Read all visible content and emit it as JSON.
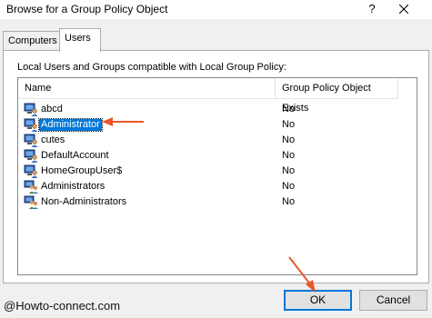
{
  "window": {
    "title": "Browse for a Group Policy Object",
    "help_label": "?"
  },
  "tabs": [
    {
      "label": "Computers",
      "active": false
    },
    {
      "label": "Users",
      "active": true
    }
  ],
  "panel": {
    "caption": "Local Users and Groups compatible with Local Group Policy:"
  },
  "list": {
    "columns": [
      "Name",
      "Group Policy Object Exists"
    ],
    "rows": [
      {
        "name": "abcd",
        "exists": "No",
        "icon": "user-icon"
      },
      {
        "name": "Administrator",
        "exists": "No",
        "icon": "user-icon",
        "selected": true
      },
      {
        "name": "cutes",
        "exists": "No",
        "icon": "user-icon"
      },
      {
        "name": "DefaultAccount",
        "exists": "No",
        "icon": "user-icon"
      },
      {
        "name": "HomeGroupUser$",
        "exists": "No",
        "icon": "user-icon"
      },
      {
        "name": "Administrators",
        "exists": "No",
        "icon": "group-icon"
      },
      {
        "name": "Non-Administrators",
        "exists": "No",
        "icon": "group-icon"
      }
    ]
  },
  "buttons": {
    "ok": "OK",
    "cancel": "Cancel"
  },
  "watermark": "@Howto-connect.com",
  "colors": {
    "selection": "#0078d7",
    "annotation_arrow": "#e8572a"
  }
}
